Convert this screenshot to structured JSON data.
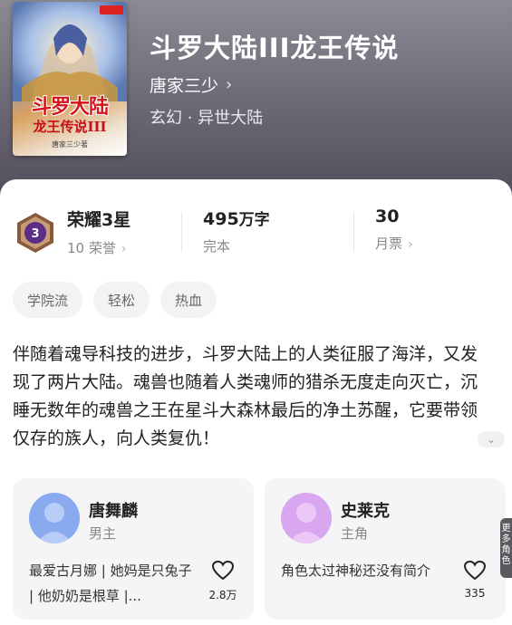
{
  "book": {
    "title": "斗罗大陆III龙王传说",
    "author": "唐家三少",
    "genre": "玄幻 · 异世大陆",
    "cover_title_line1": "斗罗大陆",
    "cover_title_line2": "龙王传说III",
    "cover_author": "唐家三少著"
  },
  "stats": {
    "honor_level": "荣耀3星",
    "honor_count": "10 荣誉",
    "medal_number": "3",
    "word_count": "495",
    "word_unit": "万字",
    "status": "完本",
    "tickets": "30",
    "tickets_label": "月票"
  },
  "tags": [
    "学院流",
    "轻松",
    "热血"
  ],
  "synopsis": "伴随着魂导科技的进步，斗罗大陆上的人类征服了海洋，又发现了两片大陆。魂兽也随着人类魂师的猎杀无度走向灭亡，沉睡无数年的魂兽之王在星斗大森林最后的净土苏醒，它要带领仅存的族人，向人类复仇！",
  "characters": [
    {
      "name": "唐舞麟",
      "role": "男主",
      "desc": "最爱古月娜 | 她妈是只兔子 | 他奶奶是根草 |...",
      "likes": "2.8万"
    },
    {
      "name": "史莱克",
      "role": "主角",
      "desc": "角色太过神秘还没有简介",
      "likes": "335"
    }
  ],
  "side_tab": "更多角色",
  "colors": {
    "header": "#6f6b78",
    "title_red": "#d4141a",
    "avatar_blue": "#8aaaf0",
    "avatar_purple": "#d9a6f0"
  },
  "icons": {
    "chevron": "›",
    "heart": "heart-icon",
    "expand": "chevron-down-icon"
  }
}
